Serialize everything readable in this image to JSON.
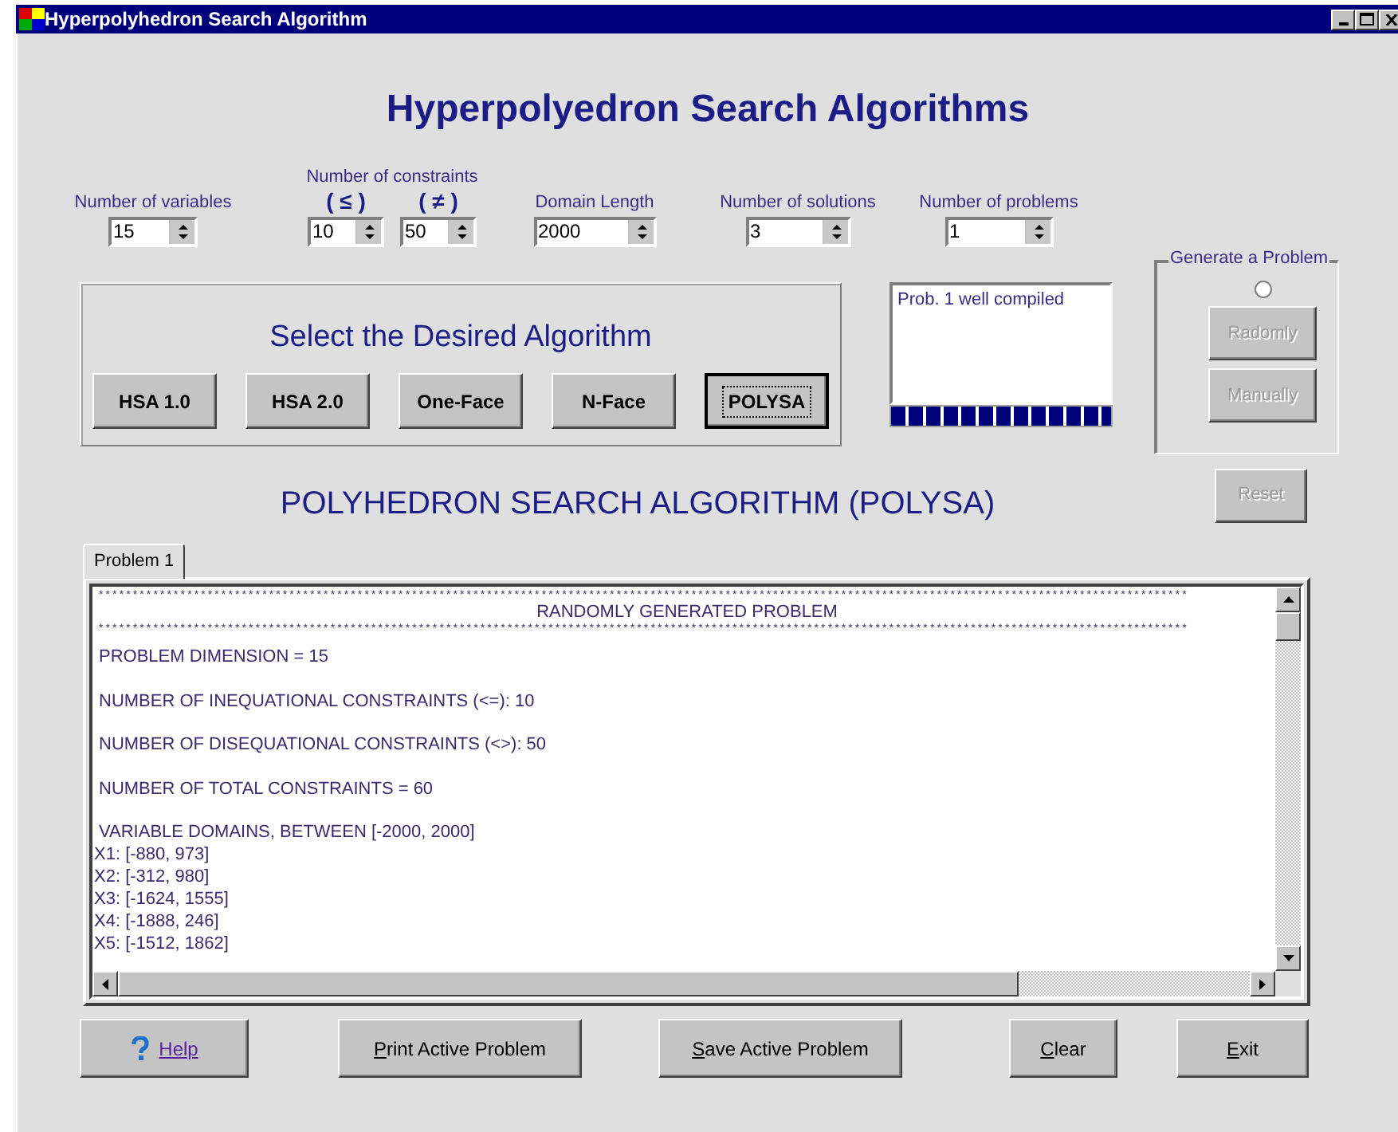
{
  "window": {
    "title": "Hyperpolyhedron Search Algorithm"
  },
  "heading": "Hyperpolyedron Search Algorithms",
  "parameters": [
    {
      "kind": "single",
      "label": "Number of variables",
      "value": "15"
    },
    {
      "kind": "group",
      "label": "Number of constraints",
      "fields": [
        {
          "label": "( ≤ )",
          "value": "10"
        },
        {
          "label": "( ≠ )",
          "value": "50"
        }
      ]
    },
    {
      "kind": "single",
      "label": "Domain Length",
      "value": "2000"
    },
    {
      "kind": "single",
      "label": "Number of solutions",
      "value": "3"
    },
    {
      "kind": "single",
      "label": "Number of problems",
      "value": "1"
    }
  ],
  "algorithm_panel": {
    "title": "Select the Desired Algorithm",
    "buttons": [
      {
        "label": "HSA 1.0",
        "selected": false
      },
      {
        "label": "HSA 2.0",
        "selected": false
      },
      {
        "label": "One-Face",
        "selected": false
      },
      {
        "label": "N-Face",
        "selected": false
      },
      {
        "label": "POLYSA",
        "selected": true
      }
    ]
  },
  "status_log": {
    "items": [
      "Prob. 1 well compiled"
    ],
    "progress": {
      "level": 1
    }
  },
  "generate_group": {
    "title": "Generate a Problem",
    "radio_selected": false,
    "buttons": [
      {
        "label": "Radomly",
        "disabled": true
      },
      {
        "label": "Manually",
        "disabled": true
      }
    ]
  },
  "algorithm_title": "POLYHEDRON SEARCH ALGORITHM (POLYSA)",
  "reset_button": {
    "label": "Reset",
    "disabled": true
  },
  "tabs": [
    {
      "label": "Problem 1",
      "selected": true
    }
  ],
  "output": {
    "lines": [
      {
        "kind": "rule",
        "text": "****************************************************************************************************************************************************************"
      },
      {
        "kind": "heading",
        "text": "RANDOMLY GENERATED PROBLEM"
      },
      {
        "kind": "rule",
        "text": "****************************************************************************************************************************************************************"
      },
      {
        "kind": "para",
        "text": "PROBLEM DIMENSION = 15"
      },
      {
        "kind": "para",
        "text": "NUMBER OF INEQUATIONAL CONSTRAINTS (<=): 10"
      },
      {
        "kind": "para",
        "text": "NUMBER OF DISEQUATIONAL CONSTRAINTS (<>): 50"
      },
      {
        "kind": "para",
        "text": "NUMBER OF TOTAL CONSTRAINTS = 60"
      },
      {
        "kind": "para",
        "text": "VARIABLE DOMAINS, BETWEEN [-2000, 2000]"
      },
      {
        "kind": "entry",
        "text": "X1: [-880, 973]"
      },
      {
        "kind": "entry",
        "text": "X2: [-312, 980]"
      },
      {
        "kind": "entry",
        "text": "X3: [-1624, 1555]"
      },
      {
        "kind": "entry",
        "text": "X4: [-1888, 246]"
      },
      {
        "kind": "entry",
        "text": "X5: [-1512, 1862]"
      }
    ]
  },
  "buttons": [
    {
      "kind": "help",
      "label": "Help"
    },
    {
      "kind": "plain",
      "label": "Print Active Problem"
    },
    {
      "kind": "plain",
      "label": "Save Active Problem"
    },
    {
      "kind": "plain",
      "label": "Clear"
    },
    {
      "kind": "plain",
      "label": "Exit"
    }
  ]
}
